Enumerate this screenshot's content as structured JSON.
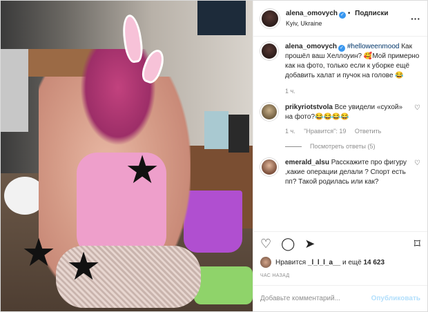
{
  "header": {
    "username": "alena_omovych",
    "follow_label": "Подписки",
    "location": "Kyiv, Ukraine",
    "more_icon": "more-icon"
  },
  "caption": {
    "username": "alena_omovych",
    "hashtag": "#helloweenmood",
    "text": "Как прошёл ваш Хеллоуин? 🥰Мой примерно как на фото, только если к уборке ещё добавить халат и пучок на голове 😂",
    "time": "1 ч."
  },
  "comments": [
    {
      "username": "prikyriotstvola",
      "text": "Все увидели «сухой» на фото?😂😂😂😂",
      "time": "1 ч.",
      "likes": "\"Нравится\": 19",
      "reply": "Ответить",
      "view_replies": "Посмотреть ответы (5)"
    },
    {
      "username": "emerald_alsu",
      "text": "Расскажите про фигуру ,какие операции делали ? Спорт есть пп? Такой родилась или как?"
    }
  ],
  "actions": {
    "likes_prefix": "Нравится",
    "likes_user": "_l_l_l_a__",
    "likes_suffix": "и ещё",
    "likes_count": "14 623",
    "time_ago": "ЧАС НАЗАД"
  },
  "add_comment": {
    "placeholder": "Добавьте комментарий...",
    "publish_label": "Опубликовать"
  }
}
